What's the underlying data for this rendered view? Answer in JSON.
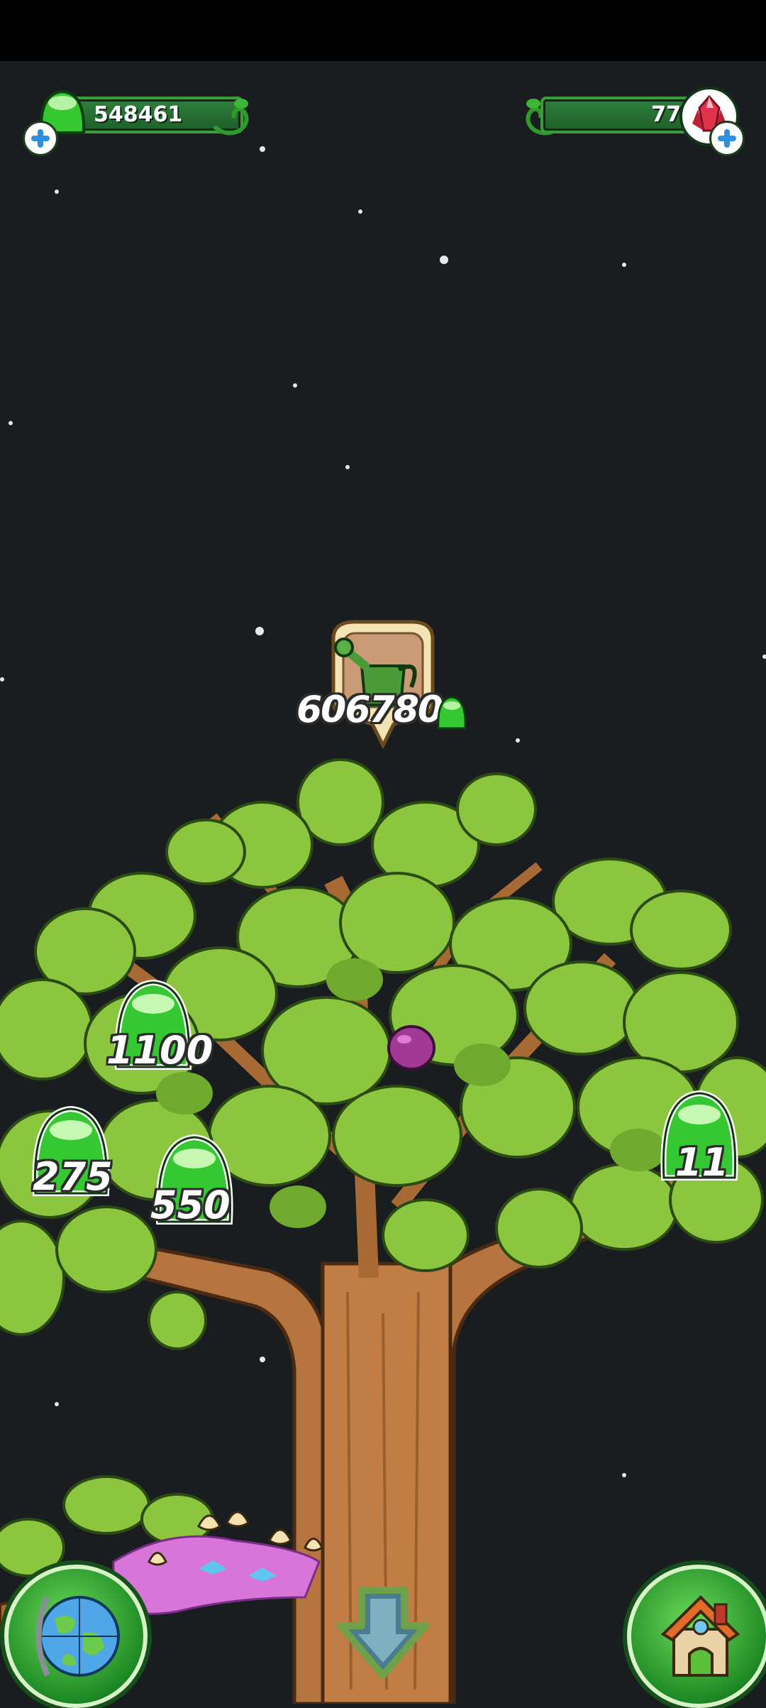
{
  "currency": {
    "slime_amount": "548461",
    "gem_amount": "77",
    "slime_icon": "green-slime-icon",
    "gem_icon": "red-crystal-icon",
    "add_icon": "plus-icon"
  },
  "upgrade": {
    "item_icon": "watering-can-icon",
    "cost": "606780"
  },
  "rewards": [
    {
      "amount": "1100"
    },
    {
      "amount": "275"
    },
    {
      "amount": "550"
    },
    {
      "amount": "11"
    }
  ],
  "buttons": {
    "world_icon": "globe-icon",
    "home_icon": "house-icon",
    "down_icon": "down-arrow-icon"
  },
  "colors": {
    "background": "#1a1d20",
    "slime_green": "#3fd23a",
    "leaf_green": "#8cc63f",
    "trunk": "#b6753f"
  }
}
